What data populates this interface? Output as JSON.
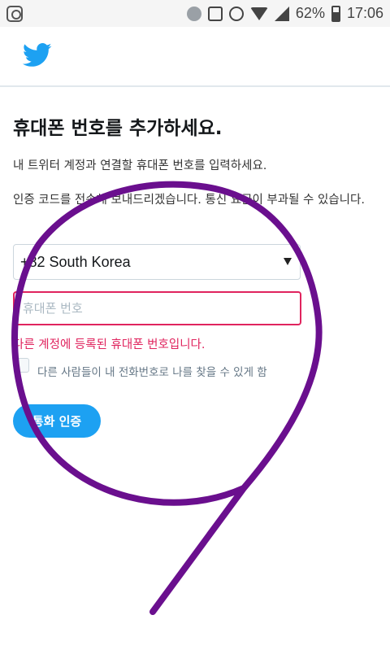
{
  "status_bar": {
    "battery": "62%",
    "time": "17:06",
    "icons": [
      "app-icon",
      "bluetooth-icon",
      "nfc-icon",
      "alarm-icon",
      "wifi-icon",
      "signal-icon",
      "battery-icon"
    ]
  },
  "header": {
    "logo": "twitter-bird-icon",
    "brand_color": "#1da1f2"
  },
  "main": {
    "title": "휴대폰 번호를 추가하세요.",
    "description": "내 트위터 계정과 연결할 휴대폰 번호를 입력하세요.",
    "notice": "인증 코드를 전송해 보내드리겠습니다. 통신 요금이 부과될 수 있습니다.",
    "country_select": {
      "value": "+82 South Korea"
    },
    "phone_input": {
      "placeholder": "휴대폰 번호",
      "value": ""
    },
    "error": "다른 계정에 등록된 휴대폰 번호입니다.",
    "discover_checkbox": {
      "label": "다른 사람들이 내 전화번호로 나를 찾을 수 있게 함",
      "checked": false
    },
    "call_verify_label": "통화 인증"
  },
  "colors": {
    "error": "#e0245e",
    "accent": "#1da1f2",
    "overlay": "#6a0f8e"
  }
}
